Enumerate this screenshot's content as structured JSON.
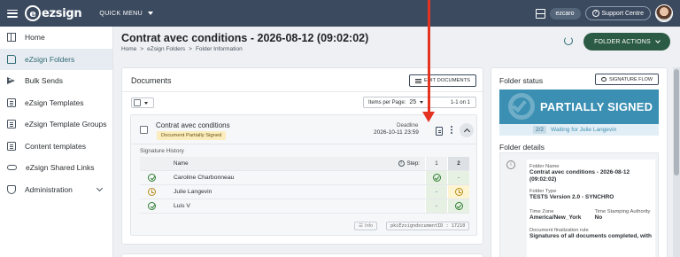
{
  "topbar": {
    "brand": "ezsign",
    "quick_menu_label": "QUICK MENU",
    "user_name": "ezcaro",
    "support_label": "Support Centre"
  },
  "sidebar": {
    "items": [
      {
        "label": "Home",
        "icon": "home-icon"
      },
      {
        "label": "eZsign Folders",
        "icon": "folder-icon",
        "active": true
      },
      {
        "label": "Bulk Sends",
        "icon": "send-icon"
      },
      {
        "label": "eZsign Templates",
        "icon": "template-icon"
      },
      {
        "label": "eZsign Template Groups",
        "icon": "template-group-icon"
      },
      {
        "label": "Content templates",
        "icon": "content-template-icon"
      },
      {
        "label": "eZsign Shared Links",
        "icon": "link-icon"
      },
      {
        "label": "Administration",
        "icon": "admin-icon",
        "has_submenu": true
      }
    ]
  },
  "header": {
    "title": "Contrat avec conditions - 2026-08-12 (09:02:02)",
    "breadcrumb": [
      "Home",
      ">",
      "eZsign Folders",
      ">",
      "Folder Information"
    ],
    "folder_actions_label": "FOLDER ACTIONS"
  },
  "documents": {
    "title": "Documents",
    "edit_label": "EDIT DOCUMENTS",
    "items_per_page_label": "Items per Page:",
    "items_per_page_value": "25",
    "range_label": "1-1 on 1",
    "document": {
      "name": "Contrat avec conditions",
      "status_badge": "Document Partially Signed",
      "deadline_label": "Deadline",
      "deadline_value": "2026-10-11 23:59",
      "signature_history_label": "Signature History",
      "table_header": {
        "name": "Name",
        "step": "Step:",
        "step1": "1",
        "step2": "2"
      },
      "rows": [
        {
          "status": "signed",
          "name": "Caroline Charbonneau",
          "step1": "signed",
          "step2": "-"
        },
        {
          "status": "waiting",
          "name": "Julie Langevin",
          "step1": "-",
          "step2": "waiting"
        },
        {
          "status": "signed",
          "name": "Luis V",
          "step1": "-",
          "step2": "signed"
        }
      ],
      "info_label": "Info",
      "doc_id": "pkiEzsigndocumentID : 17210"
    }
  },
  "folder_status": {
    "title": "Folder status",
    "signature_flow_label": "SIGNATURE FLOW",
    "status_text": "PARTIALLY SIGNED",
    "waiting_count": "2/2",
    "waiting_text": "Waiting for Julie Langevin",
    "status_color": "#3a8fb3"
  },
  "folder_details": {
    "title": "Folder details",
    "folder_name_label": "Folder Name",
    "folder_name_value": "Contrat avec conditions - 2026-08-12 (09:02:02)",
    "folder_type_label": "Folder Type",
    "folder_type_value": "TESTS Version 2.0 - SYNCHRO",
    "time_zone_label": "Time Zone",
    "time_zone_value": "America/New_York",
    "time_stamping_label": "Time Stamping Authority",
    "time_stamping_value": "No",
    "finalization_label": "Document finalization rule",
    "finalization_value": "Signatures of all documents completed, with"
  },
  "colors": {
    "topbar": "#3b4a5e",
    "accent_green": "#2c5b45",
    "badge_yellow": "#fbedbe",
    "annotation_arrow": "#e53321"
  }
}
